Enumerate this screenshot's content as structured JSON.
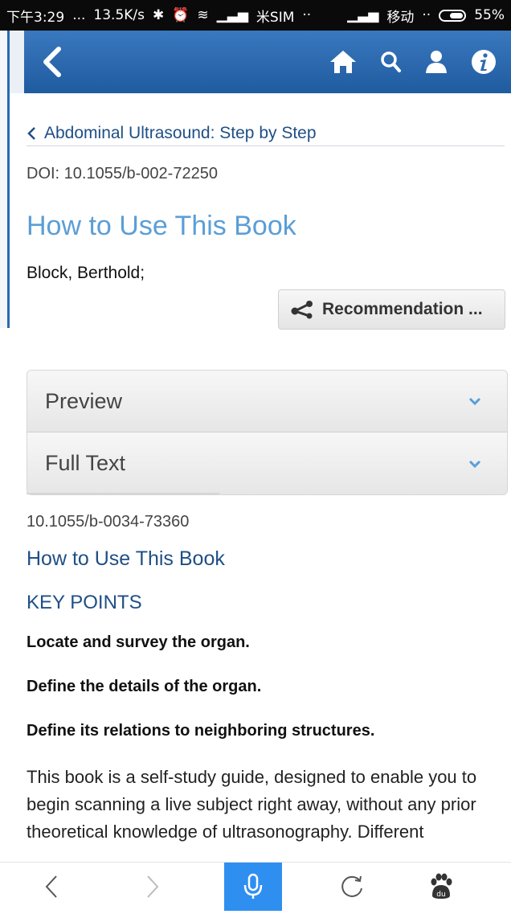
{
  "status_bar": {
    "time": "下午3:29",
    "dots": "...",
    "speed": "13.5K/s",
    "carrier1": "米SIM",
    "carrier1_dots": "··",
    "carrier2": "移动",
    "carrier2_dots": "··",
    "battery": "55%"
  },
  "header": {
    "back_icon": "chevron-left-icon",
    "actions": [
      "home-icon",
      "search-icon",
      "user-icon",
      "info-icon"
    ],
    "color": "#2a6ab1"
  },
  "breadcrumb": {
    "label": "Abdominal Ultrasound: Step by Step"
  },
  "doi": "DOI: 10.1055/b-002-72250",
  "title": "How to Use This Book",
  "author": "Block, Berthold;",
  "recommend_label": "Recommendation ...",
  "accordion": {
    "items": [
      {
        "label": "Preview"
      },
      {
        "label": "Full Text"
      }
    ]
  },
  "content": {
    "doi": "10.1055/b-0034-73360",
    "subtitle": "How to Use This Book",
    "key_points_heading": "KEY POINTS",
    "points": [
      "Locate and survey the organ.",
      "Define the details of the organ.",
      "Define its relations to neighboring structures."
    ],
    "body": "This book is a self-study guide, designed to enable you to begin scanning a live subject right away, without any prior theoretical knowledge of ultrasonography. Different"
  },
  "bottom_nav": {
    "items": [
      "back-icon",
      "forward-icon",
      "microphone-icon",
      "refresh-icon",
      "baidu-paw-icon"
    ],
    "accent": "#2f8ff0"
  }
}
